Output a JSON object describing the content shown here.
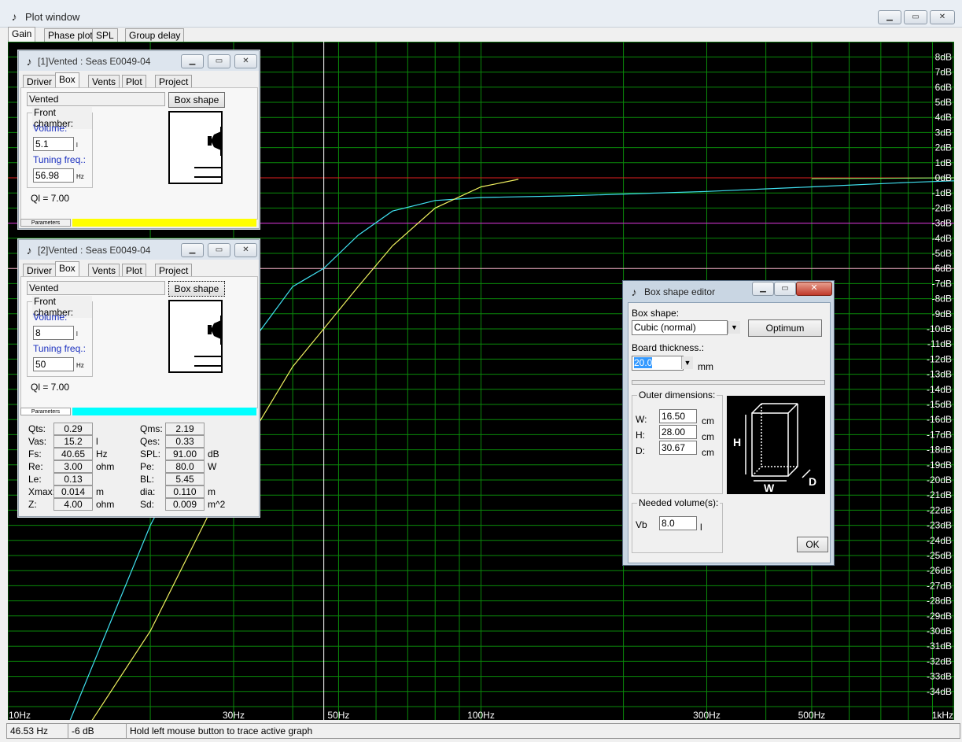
{
  "main_window": {
    "title": "Plot window",
    "caption_buttons": {
      "minimize": "▁",
      "maximize": "▭",
      "close": "✕"
    },
    "tabs": [
      "Gain",
      "Phase plot",
      "SPL",
      "Group delay"
    ],
    "active_tab": "Gain"
  },
  "chart_data": {
    "type": "line",
    "x_scale": "log",
    "xlim": [
      10,
      1000
    ],
    "ylim": [
      -36,
      9
    ],
    "x_tick_labels": [
      {
        "x": 10,
        "label": "10Hz"
      },
      {
        "x": 30,
        "label": "30Hz"
      },
      {
        "x": 50,
        "label": "50Hz"
      },
      {
        "x": 100,
        "label": "100Hz"
      },
      {
        "x": 300,
        "label": "300Hz"
      },
      {
        "x": 500,
        "label": "500Hz"
      },
      {
        "x": 1000,
        "label": "1kHz"
      }
    ],
    "y_tick_labels": [
      "8dB",
      "7dB",
      "6dB",
      "5dB",
      "4dB",
      "3dB",
      "2dB",
      "1dB",
      "0dB",
      "-1dB",
      "-2dB",
      "-3dB",
      "-4dB",
      "-5dB",
      "-6dB",
      "-7dB",
      "-8dB",
      "-9dB",
      "-10dB",
      "-11dB",
      "-12dB",
      "-13dB",
      "-14dB",
      "-15dB",
      "-16dB",
      "-17dB",
      "-18dB",
      "-19dB",
      "-20dB",
      "-21dB",
      "-22dB",
      "-23dB",
      "-24dB",
      "-25dB",
      "-26dB",
      "-27dB",
      "-28dB",
      "-29dB",
      "-30dB",
      "-31dB",
      "-32dB",
      "-33dB",
      "-34dB"
    ],
    "y_tick_values": [
      8,
      7,
      6,
      5,
      4,
      3,
      2,
      1,
      0,
      -1,
      -2,
      -3,
      -4,
      -5,
      -6,
      -7,
      -8,
      -9,
      -10,
      -11,
      -12,
      -13,
      -14,
      -15,
      -16,
      -17,
      -18,
      -19,
      -20,
      -21,
      -22,
      -23,
      -24,
      -25,
      -26,
      -27,
      -28,
      -29,
      -30,
      -31,
      -32,
      -33,
      -34
    ],
    "grid": true,
    "reference_lines": [
      {
        "y": 0,
        "color": "#e02020"
      },
      {
        "y": -3,
        "color": "#e020e0"
      },
      {
        "y": -6,
        "color": "#ff9ccf"
      }
    ],
    "cursor_x": 46.53,
    "series": [
      {
        "color": "#40e0f0",
        "x": [
          13.5,
          20,
          30,
          40,
          46.5,
          55,
          65,
          80,
          100,
          150,
          300,
          500,
          800,
          1000
        ],
        "y": [
          -36,
          -23,
          -12.5,
          -7.2,
          -6,
          -3.8,
          -2.2,
          -1.5,
          -1.3,
          -1.2,
          -0.9,
          -0.6,
          -0.3,
          -0.2
        ]
      },
      {
        "color": "#f0f060",
        "x": [
          15,
          20,
          30,
          40,
          46.5,
          55,
          65,
          80,
          100,
          120
        ],
        "y": [
          -36,
          -30,
          -19,
          -12.5,
          -10,
          -7.2,
          -4.5,
          -2,
          -0.6,
          -0.1
        ]
      },
      {
        "color": "#7fe060",
        "x": [
          500,
          800,
          1000
        ],
        "y": [
          -0.05,
          -0.02,
          0
        ]
      }
    ]
  },
  "status_bar": {
    "frequency": "46.53 Hz",
    "level": "-6 dB",
    "hint": "Hold left mouse button to trace active graph"
  },
  "child1": {
    "title": "[1]Vented : Seas E0049-04",
    "tabs": [
      "Driver",
      "Box",
      "Vents",
      "Plot",
      "Project"
    ],
    "active_tab": "Box",
    "box_type": "Vented",
    "box_shape_button": "Box shape",
    "front_chamber_label": "Front chamber:",
    "volume_label": "Volume:",
    "volume_value": "5.1",
    "volume_unit": "l",
    "tuning_label": "Tuning freq.:",
    "tuning_value": "56.98",
    "tuning_unit": "Hz",
    "ql": "Ql = 7.00",
    "parameters_tab": "Parameters",
    "color": "#ffff00"
  },
  "child2": {
    "title": "[2]Vented : Seas E0049-04",
    "tabs": [
      "Driver",
      "Box",
      "Vents",
      "Plot",
      "Project"
    ],
    "active_tab": "Box",
    "box_type": "Vented",
    "box_shape_button": "Box shape",
    "front_chamber_label": "Front chamber:",
    "volume_label": "Volume:",
    "volume_value": "8",
    "volume_unit": "l",
    "tuning_label": "Tuning freq.:",
    "tuning_value": "50",
    "tuning_unit": "Hz",
    "ql": "Ql = 7.00",
    "parameters_tab": "Parameters",
    "color": "#00ffff",
    "params_left": [
      {
        "label": "Qts:",
        "value": "0.29",
        "unit": ""
      },
      {
        "label": "Vas:",
        "value": "15.2",
        "unit": "l"
      },
      {
        "label": "Fs:",
        "value": "40.65",
        "unit": "Hz"
      },
      {
        "label": "Re:",
        "value": "3.00",
        "unit": "ohm"
      },
      {
        "label": "Le:",
        "value": "0.13",
        "unit": ""
      },
      {
        "label": "Xmax:",
        "value": "0.014",
        "unit": "m"
      },
      {
        "label": "Z:",
        "value": "4.00",
        "unit": "ohm"
      }
    ],
    "params_right": [
      {
        "label": "Qms:",
        "value": "2.19",
        "unit": ""
      },
      {
        "label": "Qes:",
        "value": "0.33",
        "unit": ""
      },
      {
        "label": "SPL:",
        "value": "91.00",
        "unit": "dB"
      },
      {
        "label": "Pe:",
        "value": "80.0",
        "unit": "W"
      },
      {
        "label": "BL:",
        "value": "5.45",
        "unit": ""
      },
      {
        "label": "dia:",
        "value": "0.110",
        "unit": "m"
      },
      {
        "label": "Sd:",
        "value": "0.009",
        "unit": "m^2"
      }
    ]
  },
  "dialog": {
    "title": "Box shape editor",
    "box_shape_label": "Box shape:",
    "box_shape_value": "Cubic (normal)",
    "optimum_button": "Optimum",
    "board_thickness_label": "Board thickness.:",
    "board_thickness_value": "20.0",
    "board_thickness_unit": "mm",
    "outer_dimensions_label": "Outer dimensions:",
    "w_label": "W:",
    "w_value": "16.50",
    "h_label": "H:",
    "h_value": "28.00",
    "d_label": "D:",
    "d_value": "30.67",
    "dim_unit": "cm",
    "diagram_labels": {
      "h": "H",
      "w": "W",
      "d": "D"
    },
    "needed_volume_label": "Needed volume(s):",
    "vb_label": "Vb",
    "vb_value": "8.0",
    "vb_unit": "l",
    "ok_button": "OK"
  }
}
